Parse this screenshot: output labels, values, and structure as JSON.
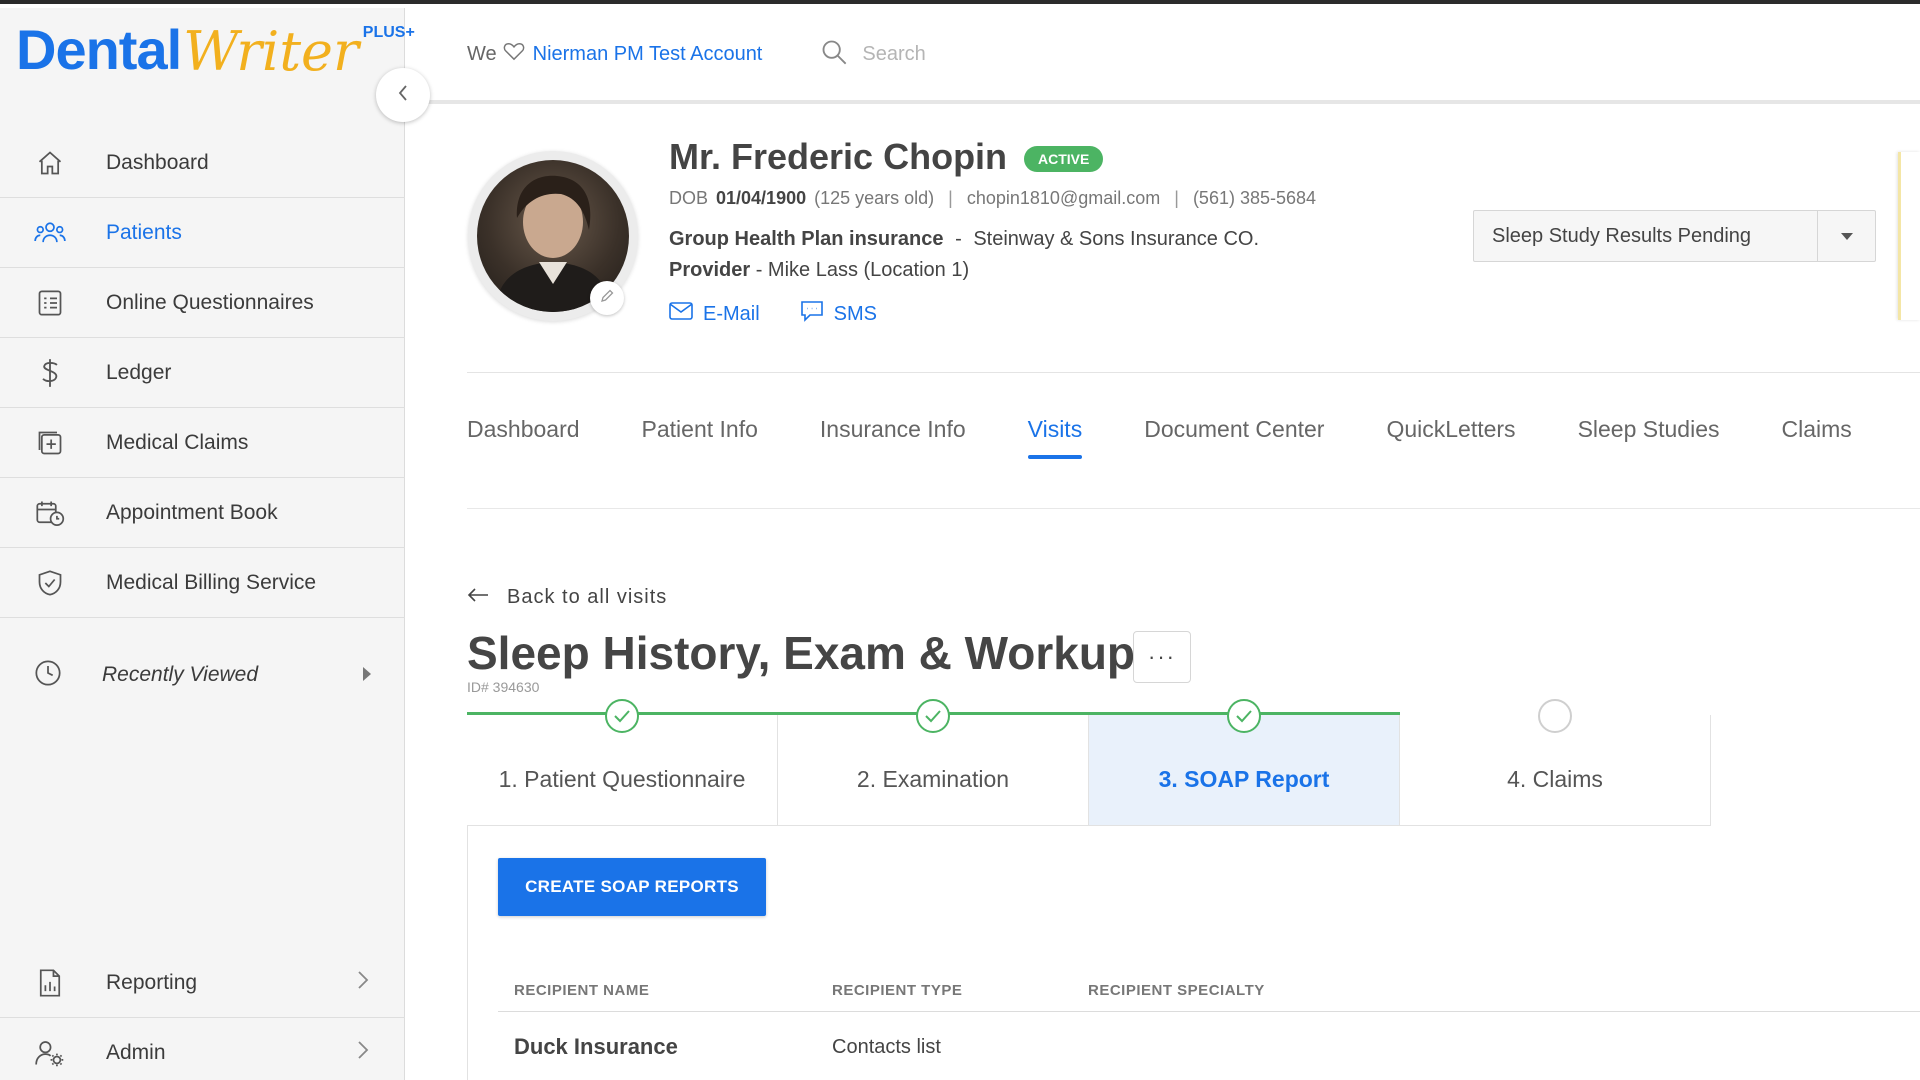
{
  "app": {
    "logo_main": "Dental",
    "logo_script": "Writer",
    "logo_plus": "PLUS+"
  },
  "sidebar": {
    "items": [
      {
        "label": "Dashboard",
        "icon": "home-icon",
        "active": false
      },
      {
        "label": "Patients",
        "icon": "users-icon",
        "active": true
      },
      {
        "label": "Online Questionnaires",
        "icon": "checklist-icon",
        "active": false
      },
      {
        "label": "Ledger",
        "icon": "dollar-icon",
        "active": false
      },
      {
        "label": "Medical Claims",
        "icon": "medical-claims-icon",
        "active": false
      },
      {
        "label": "Appointment Book",
        "icon": "calendar-clock-icon",
        "active": false
      },
      {
        "label": "Medical Billing Service",
        "icon": "shield-check-icon",
        "active": false
      }
    ],
    "recently_viewed": "Recently Viewed",
    "bottom_items": [
      {
        "label": "Reporting",
        "icon": "report-icon"
      },
      {
        "label": "Admin",
        "icon": "admin-icon"
      }
    ]
  },
  "header": {
    "we_text": "We",
    "account_name": "Nierman PM Test Account",
    "search_placeholder": "Search"
  },
  "patient": {
    "name": "Mr. Frederic Chopin",
    "status": "ACTIVE",
    "dob_label": "DOB",
    "dob": "01/04/1900",
    "age": "(125 years old)",
    "email": "chopin1810@gmail.com",
    "phone": "(561) 385-5684",
    "insurance_label": "Group Health Plan insurance",
    "insurance_sep": "-",
    "insurance_company": "Steinway & Sons Insurance CO.",
    "provider_label": "Provider",
    "provider_value": "- Mike Lass (Location 1)",
    "email_action": "E-Mail",
    "sms_action": "SMS",
    "status_select_value": "Sleep Study Results Pending"
  },
  "tabs": [
    {
      "label": "Dashboard",
      "active": false
    },
    {
      "label": "Patient Info",
      "active": false
    },
    {
      "label": "Insurance Info",
      "active": false
    },
    {
      "label": "Visits",
      "active": true
    },
    {
      "label": "Document Center",
      "active": false
    },
    {
      "label": "QuickLetters",
      "active": false
    },
    {
      "label": "Sleep Studies",
      "active": false
    },
    {
      "label": "Claims",
      "active": false
    }
  ],
  "visit": {
    "back_label": "Back to all visits",
    "title": "Sleep History, Exam & Workup",
    "more_label": "···",
    "id_label": "ID# 394630",
    "steps": [
      {
        "label": "1. Patient Questionnaire",
        "done": true,
        "current": false
      },
      {
        "label": "2. Examination",
        "done": true,
        "current": false
      },
      {
        "label": "3. SOAP Report",
        "done": true,
        "current": true
      },
      {
        "label": "4. Claims",
        "done": false,
        "current": false
      }
    ],
    "create_button": "CREATE SOAP REPORTS",
    "table": {
      "headers": [
        "RECIPIENT NAME",
        "RECIPIENT TYPE",
        "RECIPIENT SPECIALTY"
      ],
      "rows": [
        [
          "Duck Insurance",
          "Contacts list",
          ""
        ]
      ]
    }
  },
  "colors": {
    "accent": "#1a73e8",
    "success": "#4cb463",
    "logo_gold": "#f2b01e"
  }
}
